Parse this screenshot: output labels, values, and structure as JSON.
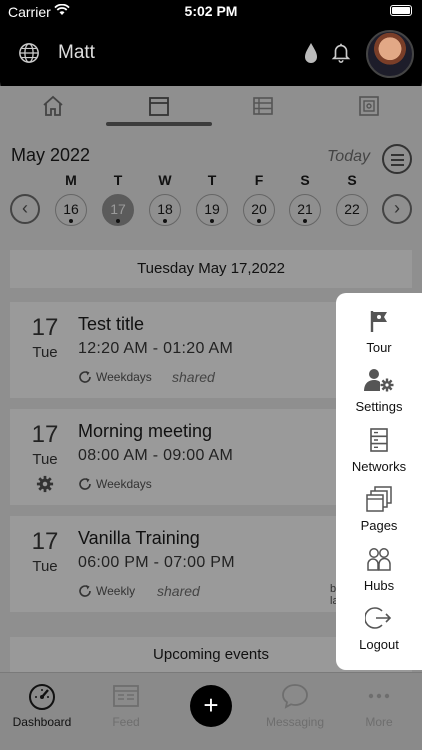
{
  "status": {
    "carrier": "Carrier",
    "time": "5:02 PM"
  },
  "header": {
    "username": "Matt",
    "icons": [
      "globe-icon",
      "water-drop-icon",
      "bell-icon"
    ]
  },
  "tabs": [
    "home-icon",
    "calendar-icon",
    "list-icon",
    "safe-icon"
  ],
  "calendar": {
    "month": "May 2022",
    "today_label": "Today",
    "weekdays": [
      "M",
      "T",
      "W",
      "T",
      "F",
      "S",
      "S"
    ],
    "days": [
      {
        "num": "16",
        "dot": true,
        "selected": false
      },
      {
        "num": "17",
        "dot": true,
        "selected": true
      },
      {
        "num": "18",
        "dot": true,
        "selected": false
      },
      {
        "num": "19",
        "dot": true,
        "selected": false
      },
      {
        "num": "20",
        "dot": true,
        "selected": false
      },
      {
        "num": "21",
        "dot": true,
        "selected": false
      },
      {
        "num": "22",
        "dot": false,
        "selected": false
      }
    ],
    "prev": "‹",
    "next": "›"
  },
  "date_band": "Tuesday May 17,2022",
  "events": [
    {
      "daynum": "17",
      "dayname": "Tue",
      "title": "Test title",
      "time": "12:20 AM - 01:20 AM",
      "recurrence": "Weekdays",
      "shared": "shared"
    },
    {
      "daynum": "17",
      "dayname": "Tue",
      "title": "Morning meeting",
      "time": "08:00 AM - 09:00 AM",
      "recurrence": "Weekdays",
      "shared": ""
    },
    {
      "daynum": "17",
      "dayname": "Tue",
      "title": "Vanilla Training",
      "time": "06:00 PM - 07:00 PM",
      "recurrence": "Weekly",
      "shared": "shared"
    }
  ],
  "side_fragment": [
    "b",
    "la"
  ],
  "upcoming": "Upcoming events",
  "popup_menu": [
    {
      "label": "Tour",
      "icon": "flag-icon"
    },
    {
      "label": "Settings",
      "icon": "user-gear-icon"
    },
    {
      "label": "Networks",
      "icon": "server-icon"
    },
    {
      "label": "Pages",
      "icon": "pages-icon"
    },
    {
      "label": "Hubs",
      "icon": "people-icon"
    },
    {
      "label": "Logout",
      "icon": "logout-icon"
    }
  ],
  "bottom_nav": [
    {
      "label": "Dashboard",
      "icon": "speedometer-icon"
    },
    {
      "label": "Feed",
      "icon": "feed-icon"
    },
    {
      "label": "+",
      "icon": "plus-icon"
    },
    {
      "label": "Messaging",
      "icon": "chat-icon"
    },
    {
      "label": "More",
      "icon": "more-icon"
    }
  ]
}
